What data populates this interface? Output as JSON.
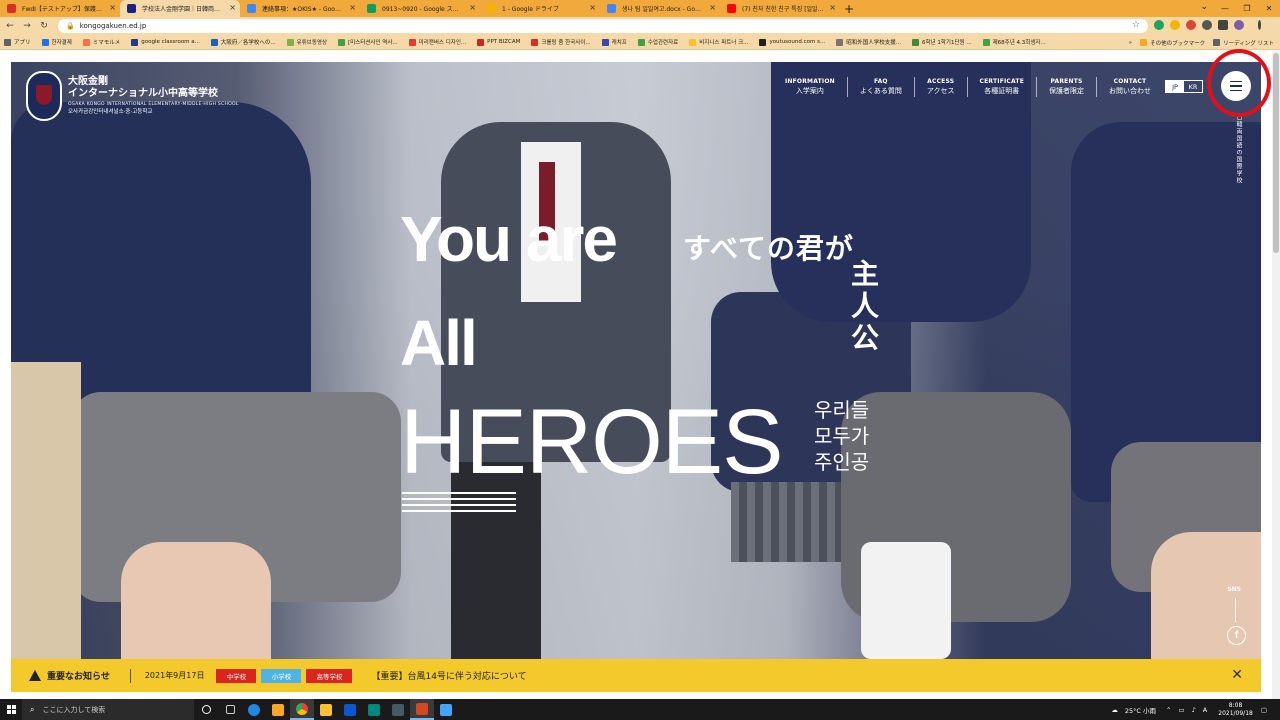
{
  "browser": {
    "tabs": [
      {
        "label": "FwdI【テストアップ】保護者ページ-上",
        "color": "#d93025",
        "active": false
      },
      {
        "label": "学校法人金剛学園｜日韓両国語",
        "color": "#1a237e",
        "active": true
      },
      {
        "label": "連絡事項：★OKIS★ - Google",
        "color": "#4285f4",
        "active": false
      },
      {
        "label": "0913~0920 - Google スプレッドシー",
        "color": "#0f9d58",
        "active": false
      },
      {
        "label": "1 - Google ドライブ",
        "color": "#f4b400",
        "active": false
      },
      {
        "label": "생나 팀 일일여고.docx - Google",
        "color": "#4285f4",
        "active": false
      },
      {
        "label": "(7) 친자 친한 친구 특징 [일일여...",
        "color": "#ff0000",
        "active": false
      }
    ],
    "new_tab_label": "+",
    "url": "kongogakuen.ed.jp",
    "bookmarks": [
      {
        "label": "アプリ",
        "color": "#5f6368"
      },
      {
        "label": "한자결제",
        "color": "#1a73e8"
      },
      {
        "label": "ミマモルメ",
        "color": "#ff7043"
      },
      {
        "label": "google classroom a...",
        "color": "#1e3a8a"
      },
      {
        "label": "大阪府／各学校への...",
        "color": "#1565c0"
      },
      {
        "label": "유튜브동영상",
        "color": "#7cb342"
      },
      {
        "label": "[미스터션사인 역사...",
        "color": "#43a047"
      },
      {
        "label": "미리캔버스 디자인...",
        "color": "#e53935"
      },
      {
        "label": "PPT BIZCAM",
        "color": "#c62828"
      },
      {
        "label": "크롤링 줌 한국사이...",
        "color": "#d32f2f"
      },
      {
        "label": "캐치프",
        "color": "#3949ab"
      },
      {
        "label": "수업관련자료",
        "color": "#43a047"
      },
      {
        "label": "비지니스 파트너 크...",
        "color": "#fbc02d"
      },
      {
        "label": "youtusound.com s...",
        "color": "#212121"
      },
      {
        "label": "昭和外国人学校支援...",
        "color": "#757575"
      },
      {
        "label": "6학년 1학기1단원 ...",
        "color": "#388e3c"
      },
      {
        "label": "제68주년 4.3희생자...",
        "color": "#43a047"
      }
    ],
    "bookmarks_right": [
      {
        "label": "その他のブックマーク",
        "color": "#f9a825"
      },
      {
        "label": "リーディング リスト",
        "color": "#5f6368"
      }
    ]
  },
  "site": {
    "logo": {
      "name_line1": "大阪金剛",
      "name_line2": "インターナショナル小中高等学校",
      "name_en": "OSAKA KONGO INTERNATIONAL ELEMENTARY·MIDDLE·HIGH SCHOOL",
      "name_ko": "오사카금강인터내셔널소·중·고등학교"
    },
    "nav": [
      {
        "en": "INFORMATION",
        "jp": "入学案内"
      },
      {
        "en": "FAQ",
        "jp": "よくある質問"
      },
      {
        "en": "ACCESS",
        "jp": "アクセス"
      },
      {
        "en": "CERTIFICATE",
        "jp": "各種証明書"
      },
      {
        "en": "PARENTS",
        "jp": "保護者限定"
      },
      {
        "en": "CONTACT",
        "jp": "お問い合わせ"
      }
    ],
    "lang": {
      "jp": "JP",
      "ko": "KR"
    },
    "side_vertical": "日韓両国語の国際学校",
    "hero": {
      "en_line1": "You are",
      "en_line2": "All",
      "en_line3": "HEROES",
      "jp_line": "すべての君が",
      "jp_vertical": "主人公",
      "ko_line1": "우리들",
      "ko_line2": "모두가",
      "ko_line3": "주인공"
    },
    "sns_label": "SNS",
    "facebook_glyph": "f",
    "notice": {
      "title": "重要なお知らせ",
      "date": "2021年9月17日",
      "tags": [
        "中学校",
        "小学校",
        "高等学校"
      ],
      "link": "【重要】台風14号に伴う対応について",
      "close_glyph": "✕"
    }
  },
  "taskbar": {
    "search_placeholder": "ここに入力して検索",
    "weather": "25°C 小雨",
    "ime": "A",
    "time": "8:08",
    "date": "2021/09/18",
    "apps": [
      {
        "name": "task-view",
        "color": "#ffffff"
      },
      {
        "name": "widgets",
        "color": "#cccccc"
      },
      {
        "name": "edge",
        "color": "#1e88e5"
      },
      {
        "name": "store",
        "color": "#f9a825"
      },
      {
        "name": "explorer",
        "color": "#fbc02d"
      },
      {
        "name": "chrome",
        "color": "#34a853"
      },
      {
        "name": "mail",
        "color": "#0b57d0"
      },
      {
        "name": "maps",
        "color": "#00897b"
      },
      {
        "name": "terminal",
        "color": "#455a64"
      },
      {
        "name": "powerpoint",
        "color": "#d24726"
      },
      {
        "name": "photos",
        "color": "#42a5f5"
      }
    ]
  },
  "colors": {
    "tabstrip": "#f2a93b",
    "notice_bar": "#f3c92b",
    "highlight_ring": "#e3101a",
    "navy": "#1d2c5e"
  }
}
